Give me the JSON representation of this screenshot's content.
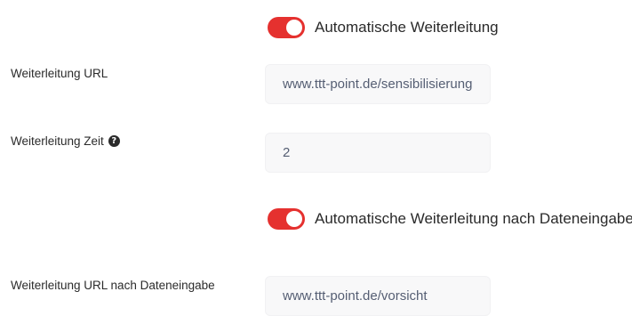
{
  "toggles": [
    {
      "label": "Automatische Weiterleitung",
      "state": "on"
    },
    {
      "label": "Automatische Weiterleitung nach Dateneingabe",
      "state": "on"
    }
  ],
  "fields": {
    "redirect_url": {
      "label": "Weiterleitung URL",
      "value": "www.ttt-point.de/sensibilisierung"
    },
    "redirect_time": {
      "label": "Weiterleitung Zeit",
      "value": "2",
      "help_icon": "question-circle-icon"
    },
    "redirect_url_after_input": {
      "label": "Weiterleitung URL nach Dateneingabe",
      "value": "www.ttt-point.de/vorsicht"
    }
  },
  "colors": {
    "toggle_on": "#e5312f",
    "input_bg": "#f8f8f9",
    "input_text": "#555e73",
    "label_text": "#2b2b2b"
  }
}
